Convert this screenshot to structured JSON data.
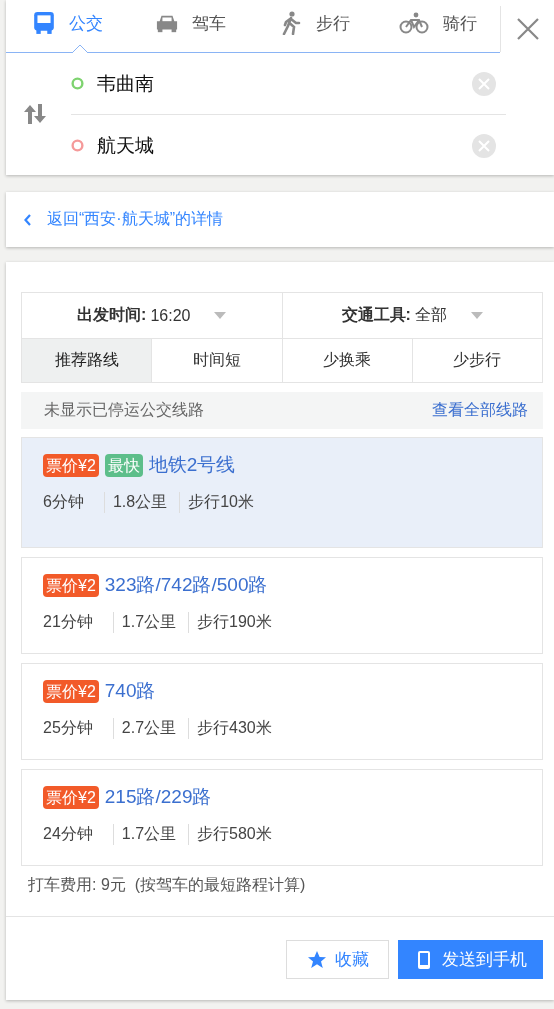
{
  "modes": [
    {
      "label": "公交",
      "kind": "bus",
      "selected": true
    },
    {
      "label": "驾车",
      "kind": "car",
      "selected": false
    },
    {
      "label": "步行",
      "kind": "walk",
      "selected": false
    },
    {
      "label": "骑行",
      "kind": "bike",
      "selected": false
    }
  ],
  "start": {
    "value": "韦曲南"
  },
  "end": {
    "value": "航天城"
  },
  "back_link": "返回“西安·航天城”的详情",
  "filters": [
    {
      "label": "出发时间:",
      "value": "16:20"
    },
    {
      "label": "交通工具:",
      "value": "全部"
    }
  ],
  "sort_tabs": [
    {
      "label": "推荐路线",
      "selected": true
    },
    {
      "label": "时间短",
      "selected": false
    },
    {
      "label": "少换乘",
      "selected": false
    },
    {
      "label": "少步行",
      "selected": false
    }
  ],
  "notice": {
    "text": "未显示已停运公交线路",
    "link": "查看全部线路"
  },
  "routes": [
    {
      "selected": true,
      "tags": [
        {
          "text": "票价¥2",
          "color": "#f25a29"
        },
        {
          "text": "最快",
          "color": "#5dbe8a"
        }
      ],
      "name": "地铁2号线",
      "stats": [
        "6分钟",
        "1.8公里",
        "步行10米"
      ]
    },
    {
      "selected": false,
      "tags": [
        {
          "text": "票价¥2",
          "color": "#f25a29"
        }
      ],
      "name": "323路/742路/500路",
      "stats": [
        "21分钟",
        "1.7公里",
        "步行190米"
      ]
    },
    {
      "selected": false,
      "tags": [
        {
          "text": "票价¥2",
          "color": "#f25a29"
        }
      ],
      "name": "740路",
      "stats": [
        "25分钟",
        "2.7公里",
        "步行430米"
      ]
    },
    {
      "selected": false,
      "tags": [
        {
          "text": "票价¥2",
          "color": "#f25a29"
        }
      ],
      "name": "215路/229路",
      "stats": [
        "24分钟",
        "1.7公里",
        "步行580米"
      ]
    }
  ],
  "taxi_note": "打车费用: 9元  (按驾车的最短路程计算)",
  "buttons": [
    {
      "label": "收藏",
      "kind": "favorite"
    },
    {
      "label": "发送到手机",
      "kind": "phone"
    }
  ]
}
